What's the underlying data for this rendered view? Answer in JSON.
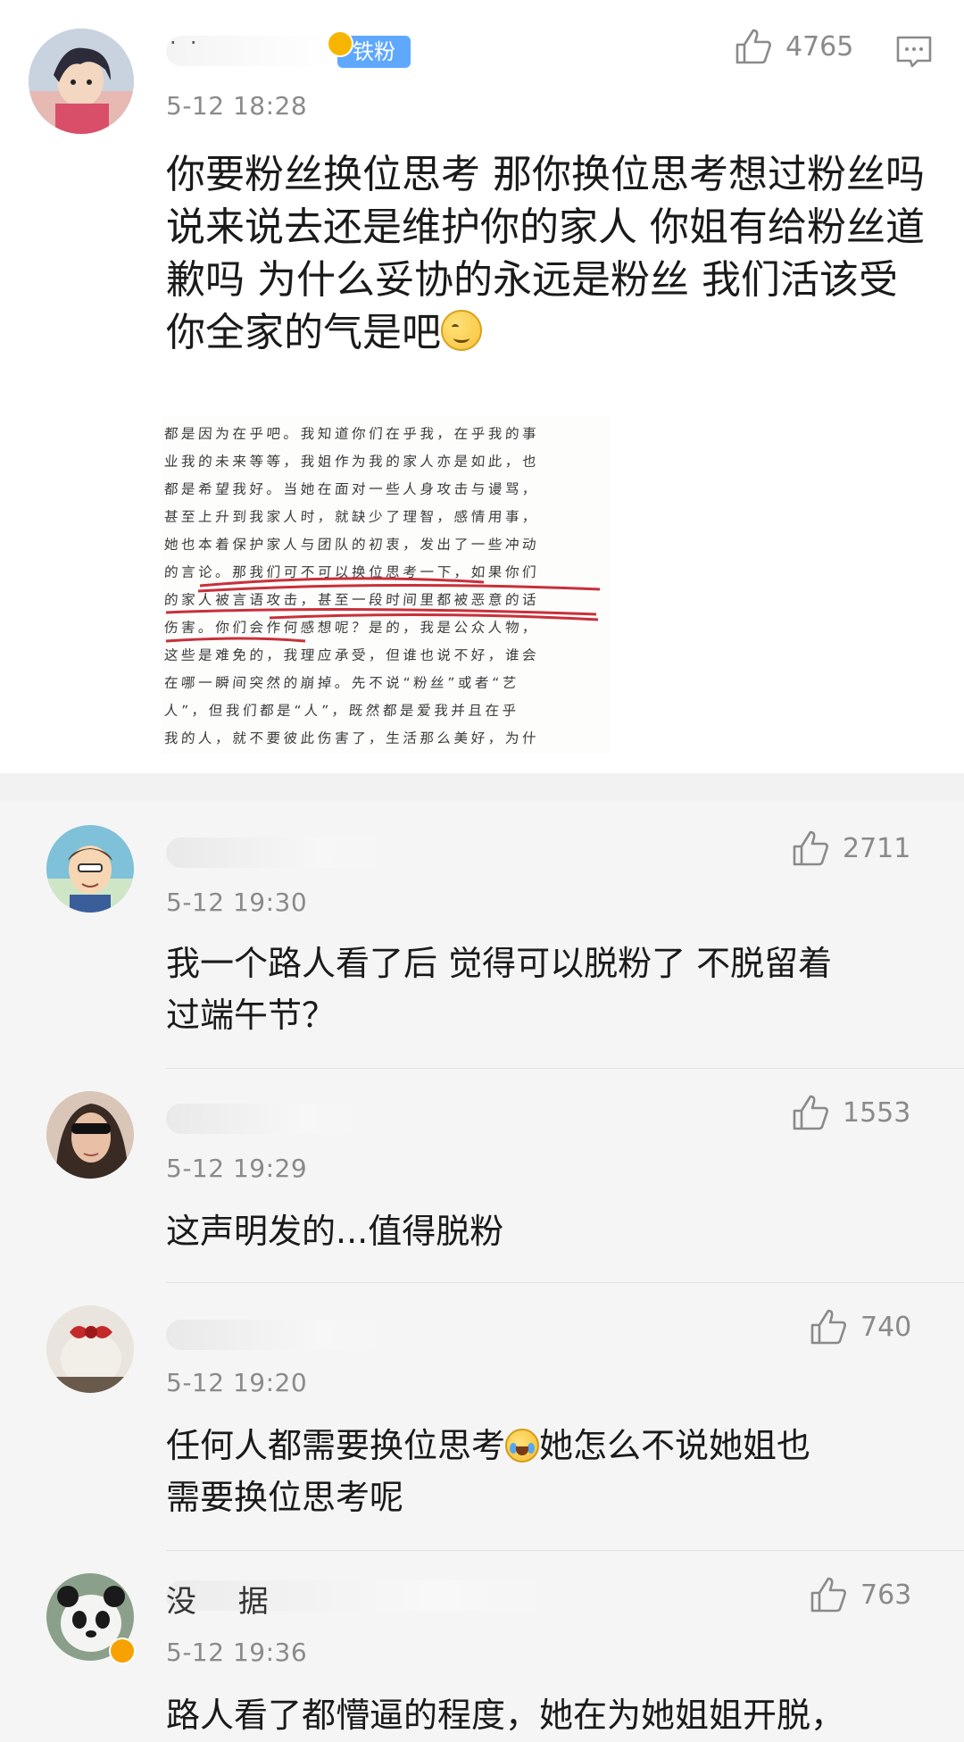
{
  "main_comment": {
    "username": "·  ·",
    "badge": "铁粉",
    "time": "5-12 18:28",
    "likes": "4765",
    "text": "你要粉丝换位思考 那你换位思考想过粉丝吗 说来说去还是维护你的家人 你姐有给粉丝道歉吗 为什么妥协的永远是粉丝 我们活该受你全家的气是吧",
    "attachment_lines": [
      "都是因为在乎吧。我知道你们在乎我，在乎我的事",
      "业我的未来等等，我姐作为我的家人亦是如此，也",
      "都是希望我好。当她在面对一些人身攻击与谩骂，",
      "甚至上升到我家人时，就缺少了理智，感情用事，",
      "她也本着保护家人与团队的初衷，发出了一些冲动",
      "的言论。那我们可不可以换位思考一下，如果你们",
      "的家人被言语攻击，甚至一段时间里都被恶意的话",
      "伤害。你们会作何感想呢？是的，我是公众人物，",
      "这些是难免的，我理应承受，但谁也说不好，谁会",
      "在哪一瞬间突然的崩掉。先不说“粉丝”或者“艺",
      "人”，但我们都是“人”，既然都是爱我并且在乎",
      "我的人，就不要彼此伤害了，生活那么美好，为什"
    ]
  },
  "replies": [
    {
      "time": "5-12 19:30",
      "likes": "2711",
      "text_lines": [
        "我一个路人看了后 觉得可以脱粉了 不脱留着",
        "过端午节？"
      ]
    },
    {
      "time": "5-12 19:29",
      "likes": "1553",
      "text_lines": [
        "这声明发的...值得脱粉"
      ]
    },
    {
      "time": "5-12 19:20",
      "likes": "740",
      "text_lines": [
        "任何人都需要换位思考",
        "需要换位思考呢"
      ],
      "text_after_emoji": "她怎么不说她姐也"
    },
    {
      "username_fragment": "没 据",
      "time": "5-12 19:36",
      "likes": "763",
      "text_lines": [
        "路人看了都懵逼的程度，她在为她姐姐开脱，"
      ]
    }
  ],
  "colors": {
    "accent": "#5ea8ff",
    "annotation_red": "#c8303a",
    "meta_gray": "#8a8a8a"
  },
  "icons": [
    "thumbs-up-icon",
    "reply-bubble-icon",
    "laugh-cry-emoji",
    "smile-emoji",
    "verified-badge-icon"
  ]
}
